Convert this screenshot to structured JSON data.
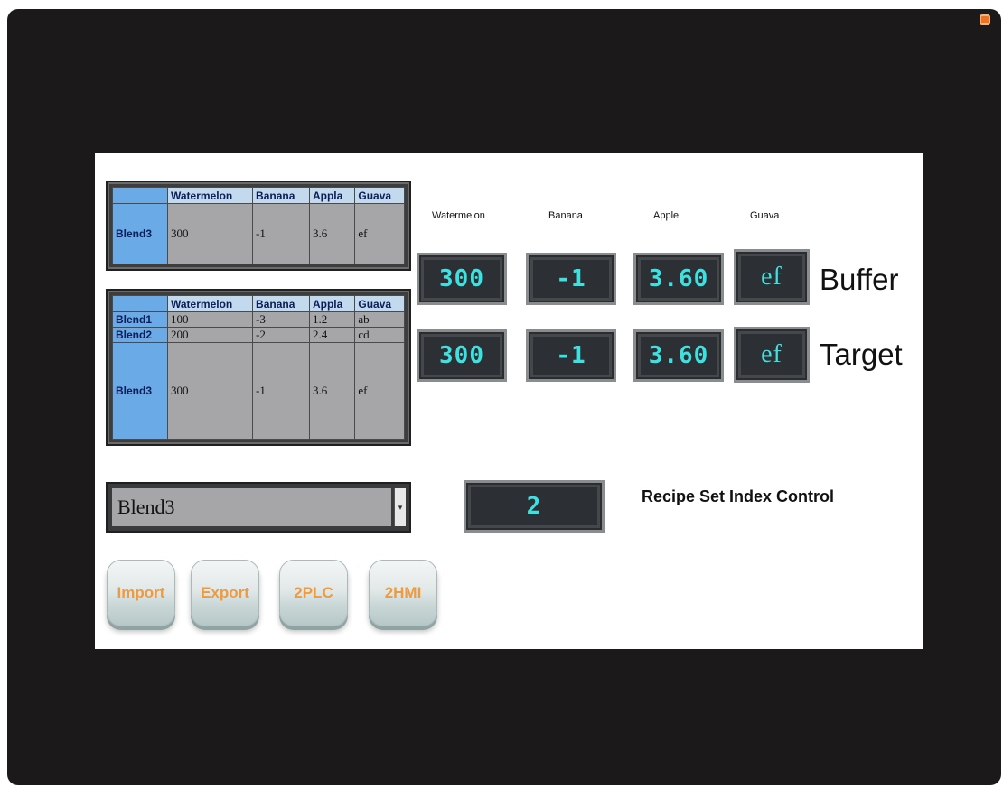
{
  "tables": {
    "buffer": {
      "headers": [
        "",
        "Watermelon",
        "Banana",
        "Appla",
        "Guava"
      ],
      "rows": [
        {
          "name": "Blend3",
          "values": [
            "300",
            "-1",
            "3.6",
            "ef"
          ]
        }
      ]
    },
    "recipes": {
      "headers": [
        "",
        "Watermelon",
        "Banana",
        "Appla",
        "Guava"
      ],
      "rows": [
        {
          "name": "Blend1",
          "values": [
            "100",
            "-3",
            "1.2",
            "ab"
          ]
        },
        {
          "name": "Blend2",
          "values": [
            "200",
            "-2",
            "2.4",
            "cd"
          ]
        },
        {
          "name": "Blend3",
          "values": [
            "300",
            "-1",
            "3.6",
            "ef"
          ]
        }
      ]
    }
  },
  "columns": [
    "Watermelon",
    "Banana",
    "Apple",
    "Guava"
  ],
  "buffer": {
    "label": "Buffer",
    "values": [
      "300",
      "-1",
      "3.60",
      "ef"
    ]
  },
  "target": {
    "label": "Target",
    "values": [
      "300",
      "-1",
      "3.60",
      "ef"
    ]
  },
  "recipe_select": {
    "value": "Blend3"
  },
  "index": {
    "value": "2",
    "label": "Recipe Set Index Control"
  },
  "buttons": {
    "import": "Import",
    "export": "Export",
    "to_plc": "2PLC",
    "to_hmi": "2HMI"
  },
  "colors": {
    "display_digits": "#3fe1e0",
    "button_text": "#f09a3b",
    "bezel": "#1b1919"
  }
}
